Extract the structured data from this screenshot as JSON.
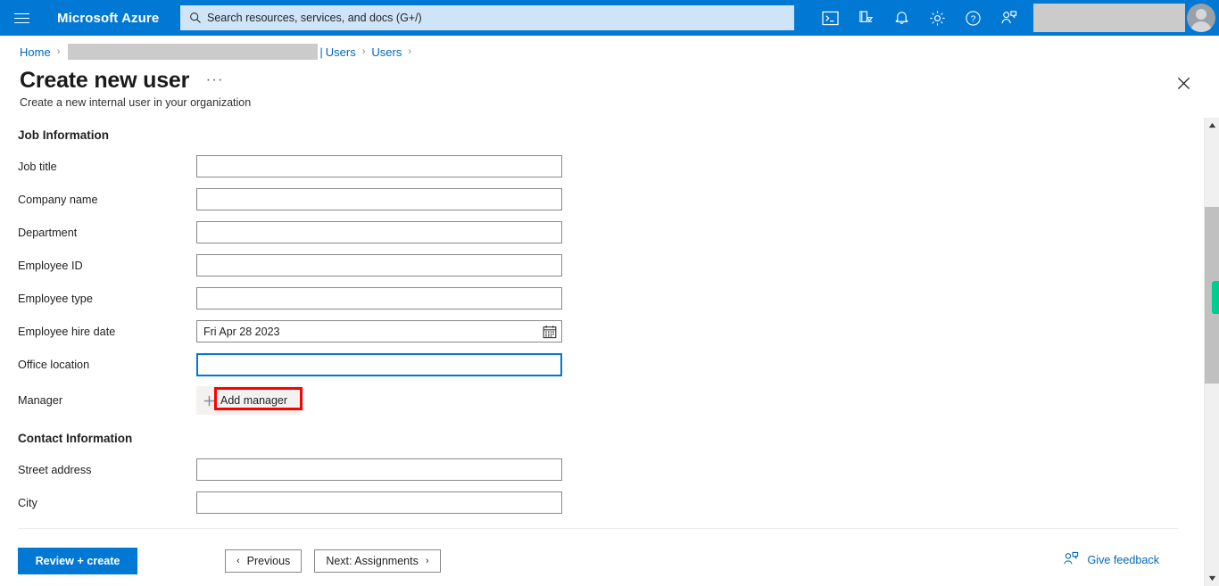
{
  "header": {
    "menu_icon": "hamburger-icon",
    "brand": "Microsoft Azure",
    "search_placeholder": "Search resources, services, and docs (G+/)",
    "icons": [
      {
        "name": "cloud-shell-icon",
        "label": "Cloud Shell"
      },
      {
        "name": "directories-subscriptions-icon",
        "label": "Directories + subscriptions"
      },
      {
        "name": "notifications-bell-icon",
        "label": "Notifications"
      },
      {
        "name": "settings-gear-icon",
        "label": "Settings"
      },
      {
        "name": "help-question-icon",
        "label": "Help"
      },
      {
        "name": "feedback-person-icon",
        "label": "Feedback"
      }
    ]
  },
  "breadcrumb": {
    "home": "Home",
    "redacted": "",
    "pipe": "|",
    "users_1": "Users",
    "users_2": "Users",
    "separator": "›"
  },
  "page": {
    "title": "Create new user",
    "more_menu": "···",
    "subtitle": "Create a new internal user in your organization",
    "close_label": "✕"
  },
  "form": {
    "sections": [
      {
        "heading": "Job Information",
        "fields": [
          {
            "label": "Job title",
            "type": "text",
            "value": "",
            "placeholder": "",
            "focused": false
          },
          {
            "label": "Company name",
            "type": "text",
            "value": "",
            "placeholder": "",
            "focused": false
          },
          {
            "label": "Department",
            "type": "text",
            "value": "",
            "placeholder": "",
            "focused": false
          },
          {
            "label": "Employee ID",
            "type": "text",
            "value": "",
            "placeholder": "",
            "focused": false
          },
          {
            "label": "Employee type",
            "type": "text",
            "value": "",
            "placeholder": "",
            "focused": false
          },
          {
            "label": "Employee hire date",
            "type": "date",
            "value": "Fri Apr 28 2023",
            "placeholder": "",
            "focused": false
          },
          {
            "label": "Office location",
            "type": "text",
            "value": "",
            "placeholder": "",
            "focused": true
          },
          {
            "label": "Manager",
            "type": "action",
            "action_label": "Add manager",
            "annotated": true
          }
        ]
      },
      {
        "heading": "Contact Information",
        "fields": [
          {
            "label": "Street address",
            "type": "text",
            "value": "",
            "placeholder": "",
            "focused": false
          },
          {
            "label": "City",
            "type": "text",
            "value": "",
            "placeholder": "",
            "focused": false
          }
        ]
      }
    ]
  },
  "footer": {
    "review_create": "Review + create",
    "previous": "Previous",
    "previous_chevron": "‹",
    "next": "Next: Assignments",
    "next_chevron": "›",
    "give_feedback": "Give feedback"
  },
  "colors": {
    "azure_blue": "#0078d4",
    "link_blue": "#0067b8",
    "annotation_red": "#ff0000",
    "scroll_marker_green": "#00cc8f",
    "redact_gray": "#cbcbcb"
  },
  "scrollbar": {
    "up_arrow": "▲",
    "down_arrow": "▼"
  }
}
